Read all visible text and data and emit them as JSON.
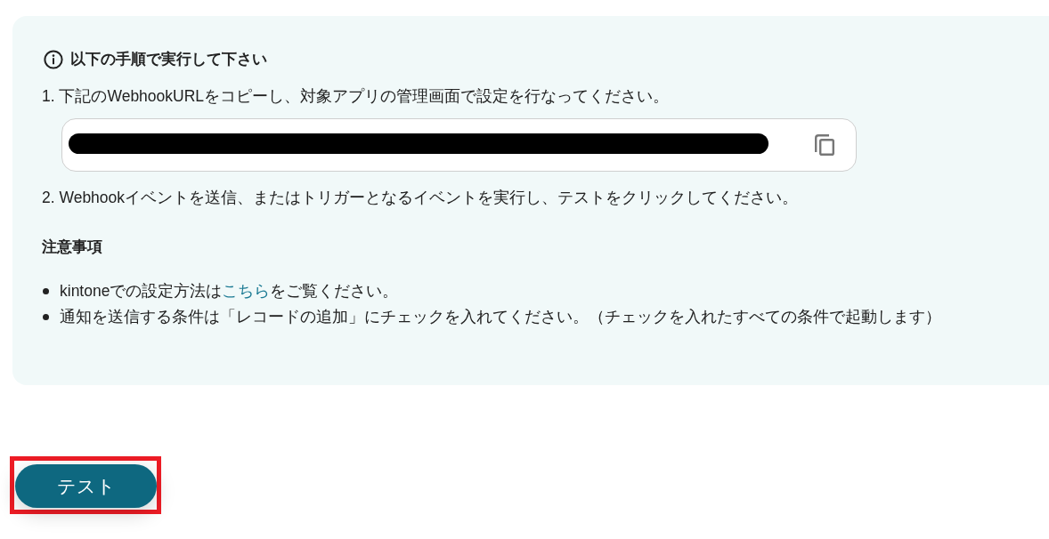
{
  "notice_panel": {
    "heading": "以下の手順で実行して下さい",
    "steps": [
      {
        "kind": "copy_url",
        "text": "1. 下記のWebhookURLをコピーし、対象アプリの管理画面で設定を行なってください。"
      },
      {
        "kind": "plain",
        "text": "2. Webhookイベントを送信、またはトリガーとなるイベントを実行し、テストをクリックしてください。"
      }
    ],
    "notes_heading": "注意事項",
    "notes": [
      [
        {
          "kind": "plain",
          "text": "kintoneでの設定方法は"
        },
        {
          "kind": "link",
          "text": "こちら"
        },
        {
          "kind": "plain",
          "text": "をご覧ください。"
        }
      ],
      [
        {
          "kind": "plain",
          "text": "通知を送信する条件は「レコードの追加」にチェックを入れてください。（チェックを入れたすべての条件で起動します）"
        }
      ]
    ]
  },
  "test_button": {
    "label": "テスト",
    "highlighted": true
  }
}
